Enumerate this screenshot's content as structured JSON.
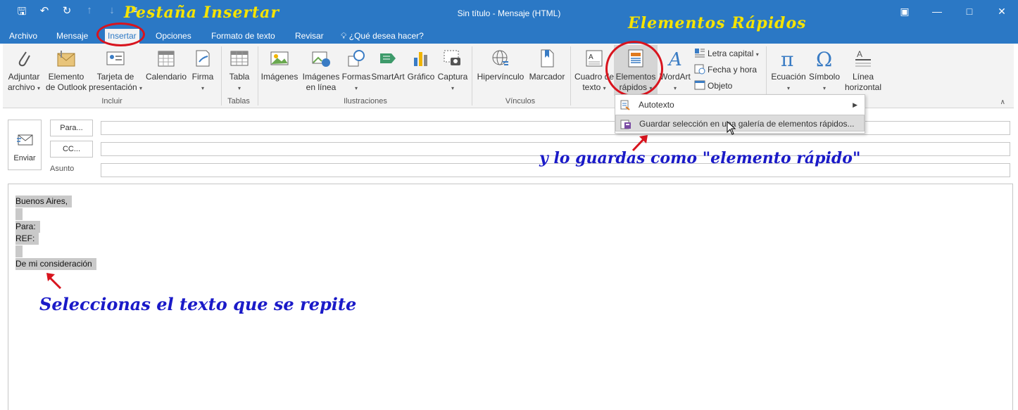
{
  "window": {
    "title": "Sin título - Mensaje (HTML)"
  },
  "tabs": {
    "archivo": "Archivo",
    "mensaje": "Mensaje",
    "insertar": "Insertar",
    "opciones": "Opciones",
    "formato": "Formato de texto",
    "revisar": "Revisar",
    "tell_me": "¿Qué desea hacer?"
  },
  "ribbon": {
    "incluir": {
      "label": "Incluir",
      "adjuntar_1": "Adjuntar",
      "adjuntar_2": "archivo",
      "elemento_1": "Elemento",
      "elemento_2": "de Outlook",
      "tarjeta_1": "Tarjeta de",
      "tarjeta_2": "presentación",
      "calendario": "Calendario",
      "firma": "Firma"
    },
    "tablas": {
      "label": "Tablas",
      "tabla": "Tabla"
    },
    "ilustraciones": {
      "label": "Ilustraciones",
      "imagenes": "Imágenes",
      "imagenes_linea_1": "Imágenes",
      "imagenes_linea_2": "en línea",
      "formas": "Formas",
      "smartart": "SmartArt",
      "grafico": "Gráfico",
      "captura": "Captura"
    },
    "vinculos": {
      "label": "Vínculos",
      "hipervinculo": "Hipervínculo",
      "marcador": "Marcador"
    },
    "texto": {
      "cuadro_1": "Cuadro de",
      "cuadro_2": "texto",
      "elementos_1": "Elementos",
      "elementos_2": "rápidos",
      "wordart": "WordArt",
      "letra_capital": "Letra capital",
      "fecha_hora": "Fecha y hora",
      "objeto": "Objeto"
    },
    "simbolos": {
      "ecuacion": "Ecuación",
      "simbolo": "Símbolo",
      "linea_1": "Línea",
      "linea_2": "horizontal"
    }
  },
  "dropdown": {
    "autotexto": "Autotexto",
    "guardar": "Guardar selección en una galería de elementos rápidos..."
  },
  "header": {
    "enviar": "Enviar",
    "para": "Para...",
    "cc": "CC...",
    "asunto": "Asunto"
  },
  "body": {
    "line1": "Buenos Aires,",
    "line2": "Para:",
    "line3": "REF:",
    "line4": "De mi consideración"
  },
  "annotations": {
    "pestana": "Pestaña Insertar",
    "elementos": "Elementos Rápidos",
    "guardas": "y lo guardas como \"elemento rápido\"",
    "selecciona": "Seleccionas el texto que se repite"
  },
  "colors": {
    "accent": "#2b78c5",
    "annotation_yellow": "#f5e300",
    "annotation_blue": "#1a1ac8",
    "annotation_red": "#d8141e",
    "selection_gray": "#c9c9c9"
  }
}
